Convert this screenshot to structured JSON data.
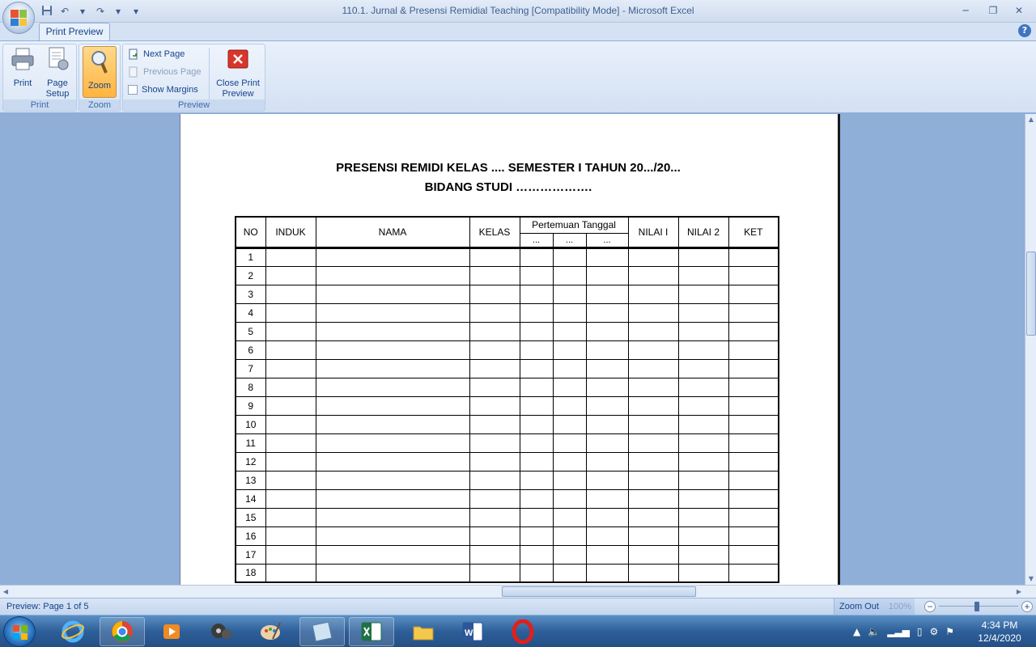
{
  "window": {
    "title": "110.1. Jurnal & Presensi Remidial Teaching  [Compatibility Mode] - Microsoft Excel"
  },
  "ribbon": {
    "active_tab": "Print Preview",
    "groups": {
      "print": {
        "label": "Print",
        "print_label": "Print",
        "page_setup_label_1": "Page",
        "page_setup_label_2": "Setup"
      },
      "zoom": {
        "label": "Zoom",
        "zoom_label": "Zoom"
      },
      "preview": {
        "label": "Preview",
        "next_page": "Next Page",
        "previous_page": "Previous Page",
        "show_margins": "Show Margins",
        "close_label_1": "Close Print",
        "close_label_2": "Preview"
      }
    }
  },
  "document": {
    "title_line_1": "PRESENSI REMIDI KELAS ....  SEMESTER I TAHUN 20.../20...",
    "title_line_2": "BIDANG STUDI ……………….",
    "columns": {
      "no": "NO",
      "induk": "INDUK",
      "nama": "NAMA",
      "kelas": "KELAS",
      "pertemuan": "Pertemuan Tanggal",
      "pertemuan_sub": [
        "...",
        "...",
        "..."
      ],
      "nilai1": "NILAI I",
      "nilai2": "NILAI 2",
      "ket": "KET"
    },
    "rows": [
      "1",
      "2",
      "3",
      "4",
      "5",
      "6",
      "7",
      "8",
      "9",
      "10",
      "11",
      "12",
      "13",
      "14",
      "15",
      "16",
      "17",
      "18"
    ]
  },
  "statusbar": {
    "preview": "Preview: Page 1 of 5",
    "zoom_out": "Zoom Out",
    "zoom_value": "100%"
  },
  "clock": {
    "time": "4:34 PM",
    "date": "12/4/2020"
  },
  "colors": {
    "ribbon_bg": "#d4e1f3",
    "workspace_bg": "#8faed8",
    "taskbar": "#2e5f99",
    "accent_zoom": "#ffb43f"
  }
}
